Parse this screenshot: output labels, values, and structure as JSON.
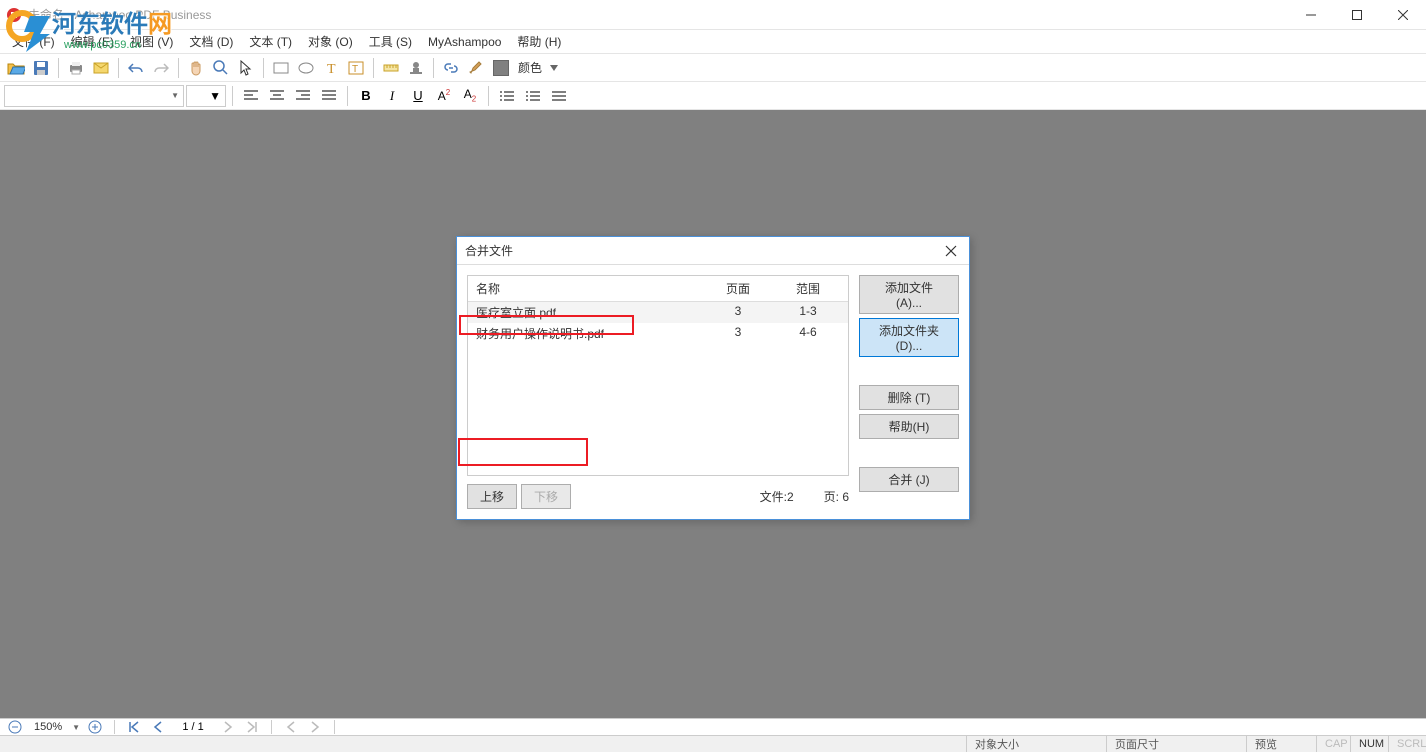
{
  "window": {
    "title": "未命名 - Ashampoo PDF Business",
    "watermark_brand_main": "河东软件",
    "watermark_brand_accent": "网",
    "watermark_url": "www.pc0359.cn"
  },
  "menu": {
    "file": "文件 (F)",
    "edit": "编辑 (E)",
    "view": "视图 (V)",
    "document": "文档 (D)",
    "text": "文本 (T)",
    "object": "对象 (O)",
    "tools": "工具 (S)",
    "myashampoo": "MyAshampoo",
    "help": "帮助 (H)"
  },
  "toolbar": {
    "color_label": "颜色"
  },
  "navbar": {
    "zoom": "150%",
    "page": "1 / 1"
  },
  "statusbar": {
    "obj_size": "对象大小",
    "page_size": "页面尺寸",
    "preview": "预览",
    "cap": "CAP",
    "num": "NUM",
    "scrl": "SCRL"
  },
  "dialog": {
    "title": "合并文件",
    "columns": {
      "name": "名称",
      "pages": "页面",
      "range": "范围"
    },
    "files": [
      {
        "name": "医疗室立面.pdf",
        "pages": "3",
        "range": "1-3"
      },
      {
        "name": "财务用户操作说明书.pdf",
        "pages": "3",
        "range": "4-6"
      }
    ],
    "buttons": {
      "up": "上移",
      "down": "下移",
      "add_file": "添加文件 (A)...",
      "add_folder": "添加文件夹 (D)...",
      "delete": "删除 (T)",
      "help": "帮助(H)",
      "merge": "合并 (J)"
    },
    "stats": {
      "files_label": "文件:",
      "files_value": "2",
      "pages_label": "页:",
      "pages_value": "6"
    }
  }
}
